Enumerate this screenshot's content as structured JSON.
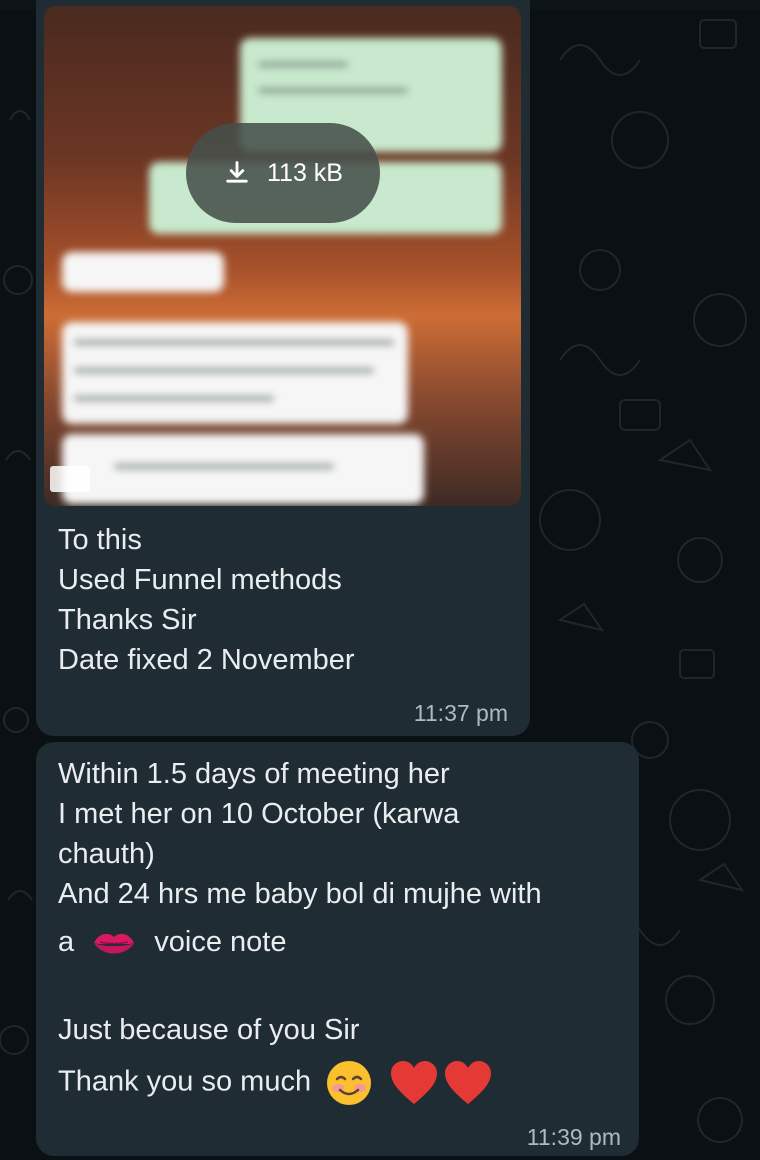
{
  "media": {
    "download_size": "113 kB",
    "icons": {
      "download": "download-icon",
      "video": "video-badge-icon"
    }
  },
  "messages": [
    {
      "lines": [
        "To this",
        "Used Funnel methods",
        "Thanks Sir",
        "Date fixed 2 November"
      ],
      "time": "11:37 pm"
    },
    {
      "lines": [
        "Within 1.5 days of meeting her",
        "I met her on 10 October (karwa",
        "chauth)",
        "And 24 hrs me baby bol di mujhe with"
      ],
      "line5_before": "a",
      "line5_emoji": "kiss-mark-emoji",
      "line5_after": "voice note",
      "line6": "Just because of you Sir",
      "line7": "Thank you so much",
      "line7_emojis": [
        "smiling-face-emoji",
        "red-heart-emoji",
        "red-heart-emoji"
      ],
      "time": "11:39 pm"
    }
  ],
  "colors": {
    "background": "#0b1014",
    "bubble": "#202c33",
    "text": "#e9edef",
    "timestamp": "#aebac1"
  }
}
